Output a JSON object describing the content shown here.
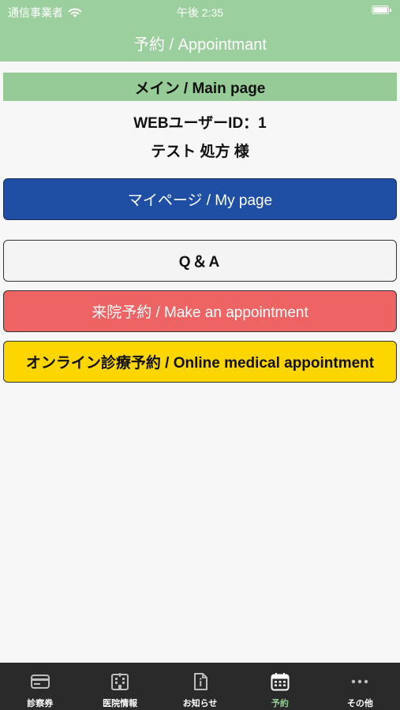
{
  "status_bar": {
    "carrier": "通信事業者",
    "time": "午後 2:35"
  },
  "header": {
    "title": "予約 / Appointmant"
  },
  "main": {
    "section_title": "メイン / Main page",
    "user_id": "WEBユーザーID：1",
    "user_name": "テスト 処方 様",
    "buttons": {
      "mypage": "マイページ / My page",
      "qa": "Q＆A",
      "appointment": "来院予約 / Make an appointment",
      "online": "オンライン診療予約 / Online medical appointment"
    }
  },
  "tabbar": {
    "items": [
      {
        "label": "診察券",
        "icon": "card-icon"
      },
      {
        "label": "医院情報",
        "icon": "building-icon"
      },
      {
        "label": "お知らせ",
        "icon": "notice-icon"
      },
      {
        "label": "予約",
        "icon": "calendar-icon",
        "active": true
      },
      {
        "label": "その他",
        "icon": "more-icon"
      }
    ]
  },
  "colors": {
    "header": "#9ccf9e",
    "mypage_button": "#1f4fa5",
    "appointment_button": "#ee6464",
    "online_button": "#fdd600",
    "tabbar": "#2a2a2a",
    "active_tab": "#8fcc93"
  }
}
